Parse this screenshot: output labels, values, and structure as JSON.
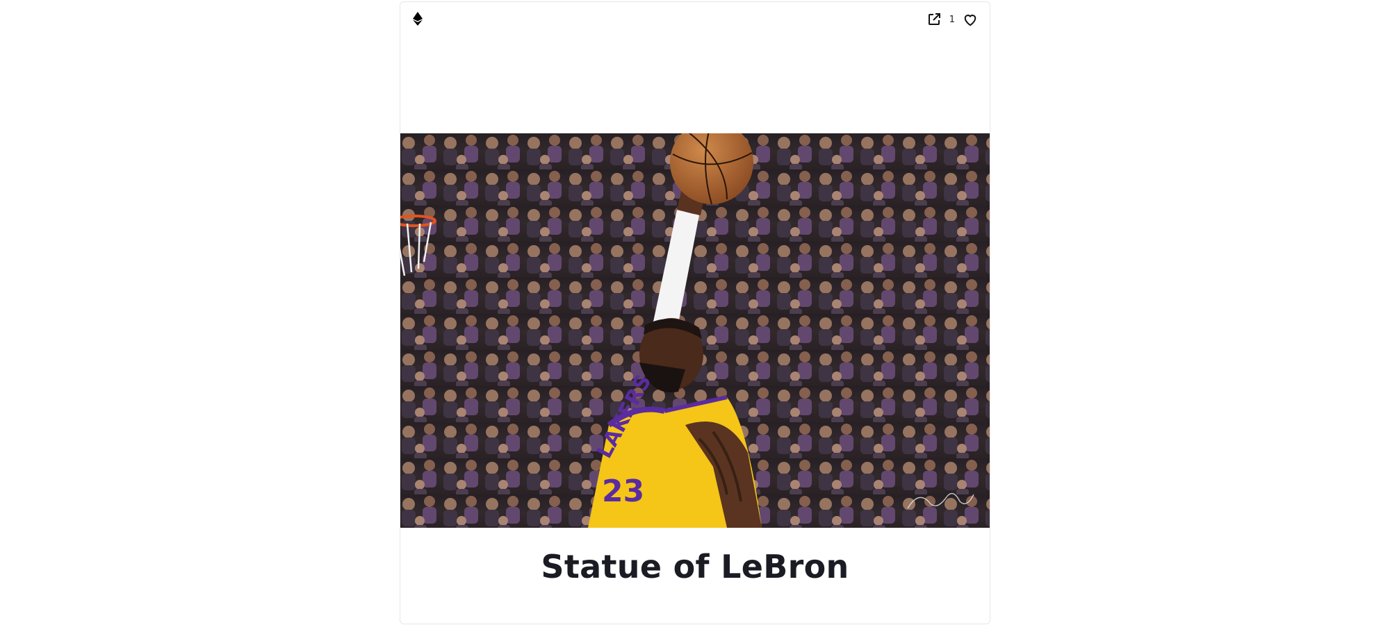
{
  "card": {
    "chain_icon": "ethereum-icon",
    "actions": {
      "external_link_icon": "external-link-icon",
      "like_count": "1",
      "like_icon": "heart-icon"
    },
    "media": {
      "alt": "Basketball player in a yellow jersey dunking a ball in front of a crowd"
    },
    "title": "Statue of LeBron"
  },
  "colors": {
    "title": "#1b1b24",
    "border": "#e6e6e6",
    "jersey": "#f5c518",
    "jersey_trim": "#5a2ca0"
  }
}
